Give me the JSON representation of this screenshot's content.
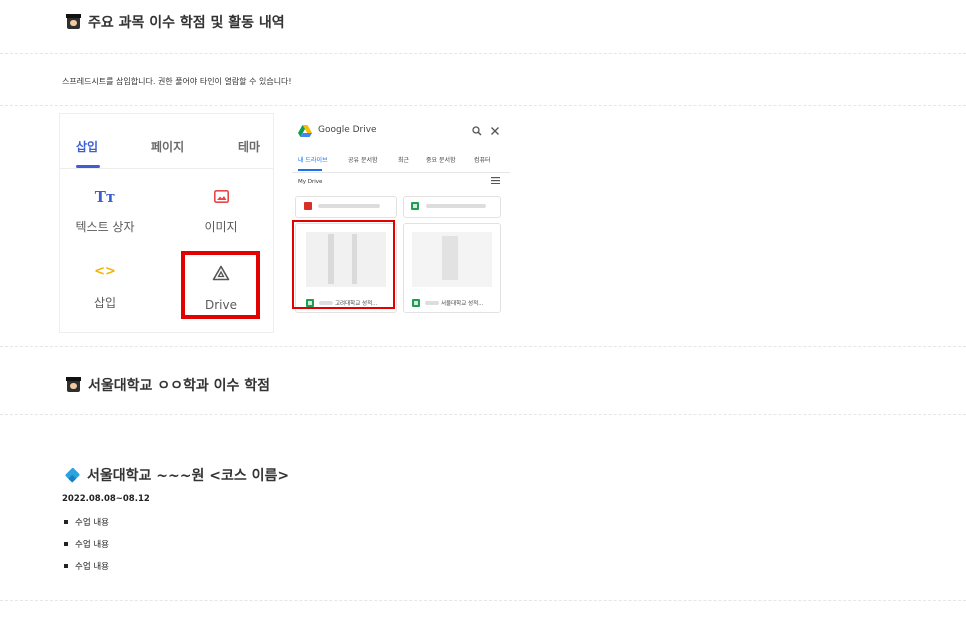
{
  "section1": {
    "title": "주요 과목 이수 학점 및 활동 내역"
  },
  "instruction": "스프레드시트를 삽입합니다. 권한 풀어야 타인이 열람할 수 있습니다!",
  "insert_panel": {
    "tabs": [
      "삽입",
      "페이지",
      "테마"
    ],
    "tiles": [
      {
        "icon": "Tт",
        "label": "텍스트 상자"
      },
      {
        "icon": "image-icon",
        "label": "이미지"
      },
      {
        "icon": "<>",
        "label": "삽입"
      },
      {
        "icon": "drive-icon",
        "label": "Drive"
      }
    ]
  },
  "drive_picker": {
    "title": "Google Drive",
    "tabs": [
      "내 드라이브",
      "공유 문서함",
      "최근",
      "중요 문서함",
      "컴퓨터"
    ],
    "breadcrumb": "My Drive",
    "files": [
      {
        "name": "고려대학교 성적..."
      },
      {
        "name": "서울대학교 성적..."
      }
    ]
  },
  "section2": {
    "title": "서울대학교 ㅇㅇ학과 이수 학점"
  },
  "section3": {
    "title": "서울대학교 ~~~원 <코스 이름>",
    "date": "2022.08.08~08.12",
    "items": [
      "수업 내용",
      "수업 내용",
      "수업 내용"
    ]
  },
  "colors": {
    "accent": "#3b5fd1",
    "highlight": "#e20000",
    "drive_blue": "#1a73e8",
    "sheets_green": "#1f9d55"
  }
}
